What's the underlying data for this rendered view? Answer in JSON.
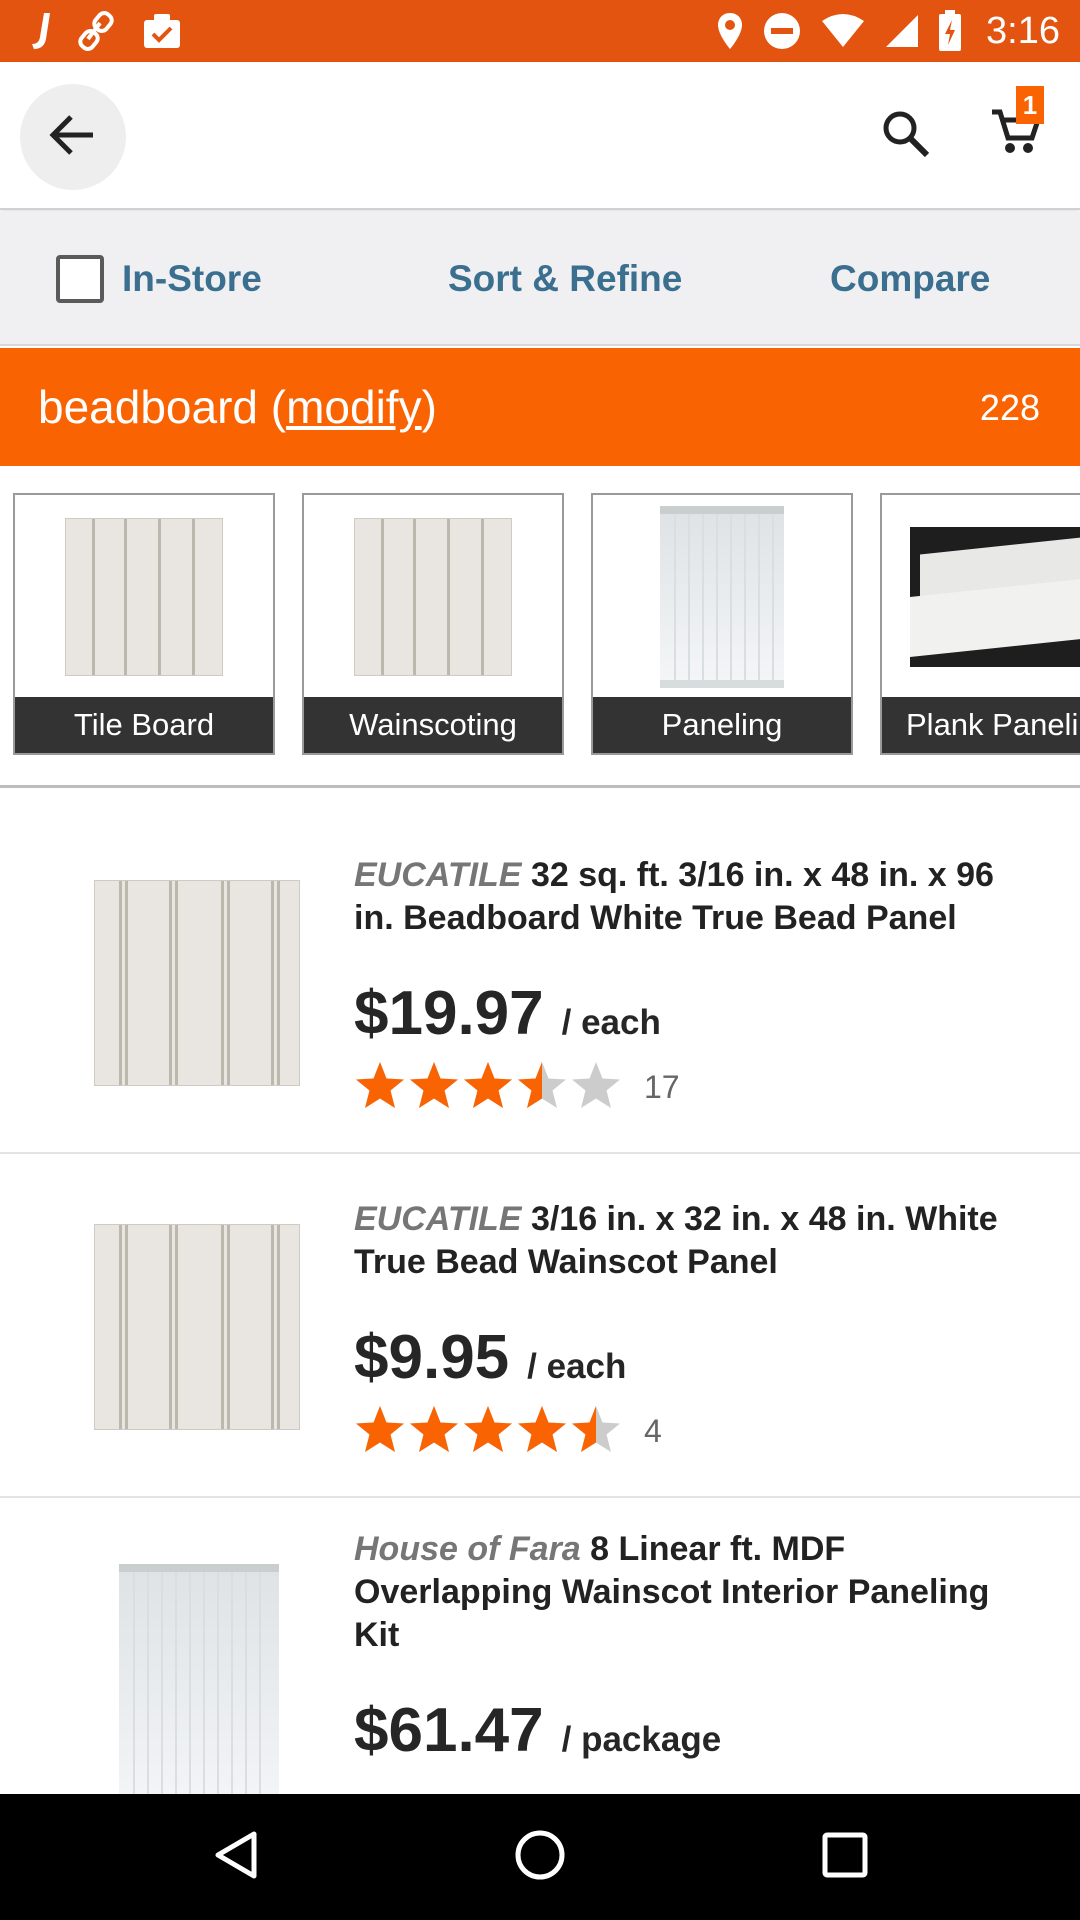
{
  "status_bar": {
    "time": "3:16",
    "left_icons": [
      "app-j-icon",
      "link-icon",
      "clipboard-check-icon"
    ],
    "right_icons": [
      "location-pin-icon",
      "do-not-disturb-icon",
      "wifi-icon",
      "cellular-signal-icon",
      "battery-charging-icon"
    ]
  },
  "app_bar": {
    "back_icon": "arrow-left-icon",
    "search_icon": "search-icon",
    "cart_icon": "shopping-cart-icon",
    "cart_count": "1"
  },
  "filter_bar": {
    "in_store_label": "In-Store",
    "in_store_checked": false,
    "sort_refine_label": "Sort & Refine",
    "compare_label": "Compare"
  },
  "search_header": {
    "query": "beadboard",
    "open_paren": "(",
    "modify_label": "modify",
    "close_paren": ")",
    "count": "228"
  },
  "categories": [
    {
      "label": "Tile Board"
    },
    {
      "label": "Wainscoting"
    },
    {
      "label": "Paneling"
    },
    {
      "label": "Plank Paneli"
    }
  ],
  "products": [
    {
      "brand": "EUCATILE",
      "title": "32 sq. ft. 3/16 in. x 48 in. x 96 in. Beadboard White True Bead Panel",
      "price": "$19.97",
      "unit": "/ each",
      "rating": 3.5,
      "review_count": "17"
    },
    {
      "brand": "EUCATILE",
      "title": "3/16 in. x 32 in. x 48 in. White True Bead Wainscot Panel",
      "price": "$9.95",
      "unit": "/ each",
      "rating": 4.5,
      "review_count": "4"
    },
    {
      "brand": "House of Fara",
      "title": "8 Linear ft. MDF Overlapping Wainscot Interior Paneling Kit",
      "price": "$61.47",
      "unit": "/ package"
    }
  ],
  "nav_bar": {
    "icons": [
      "back-triangle-icon",
      "home-circle-icon",
      "recents-square-icon"
    ]
  },
  "colors": {
    "status_bar": "#e2540f",
    "accent_orange": "#f96302",
    "link_blue": "#3b6f8f",
    "star_orange": "#f96302",
    "star_grey": "#cccccc"
  }
}
